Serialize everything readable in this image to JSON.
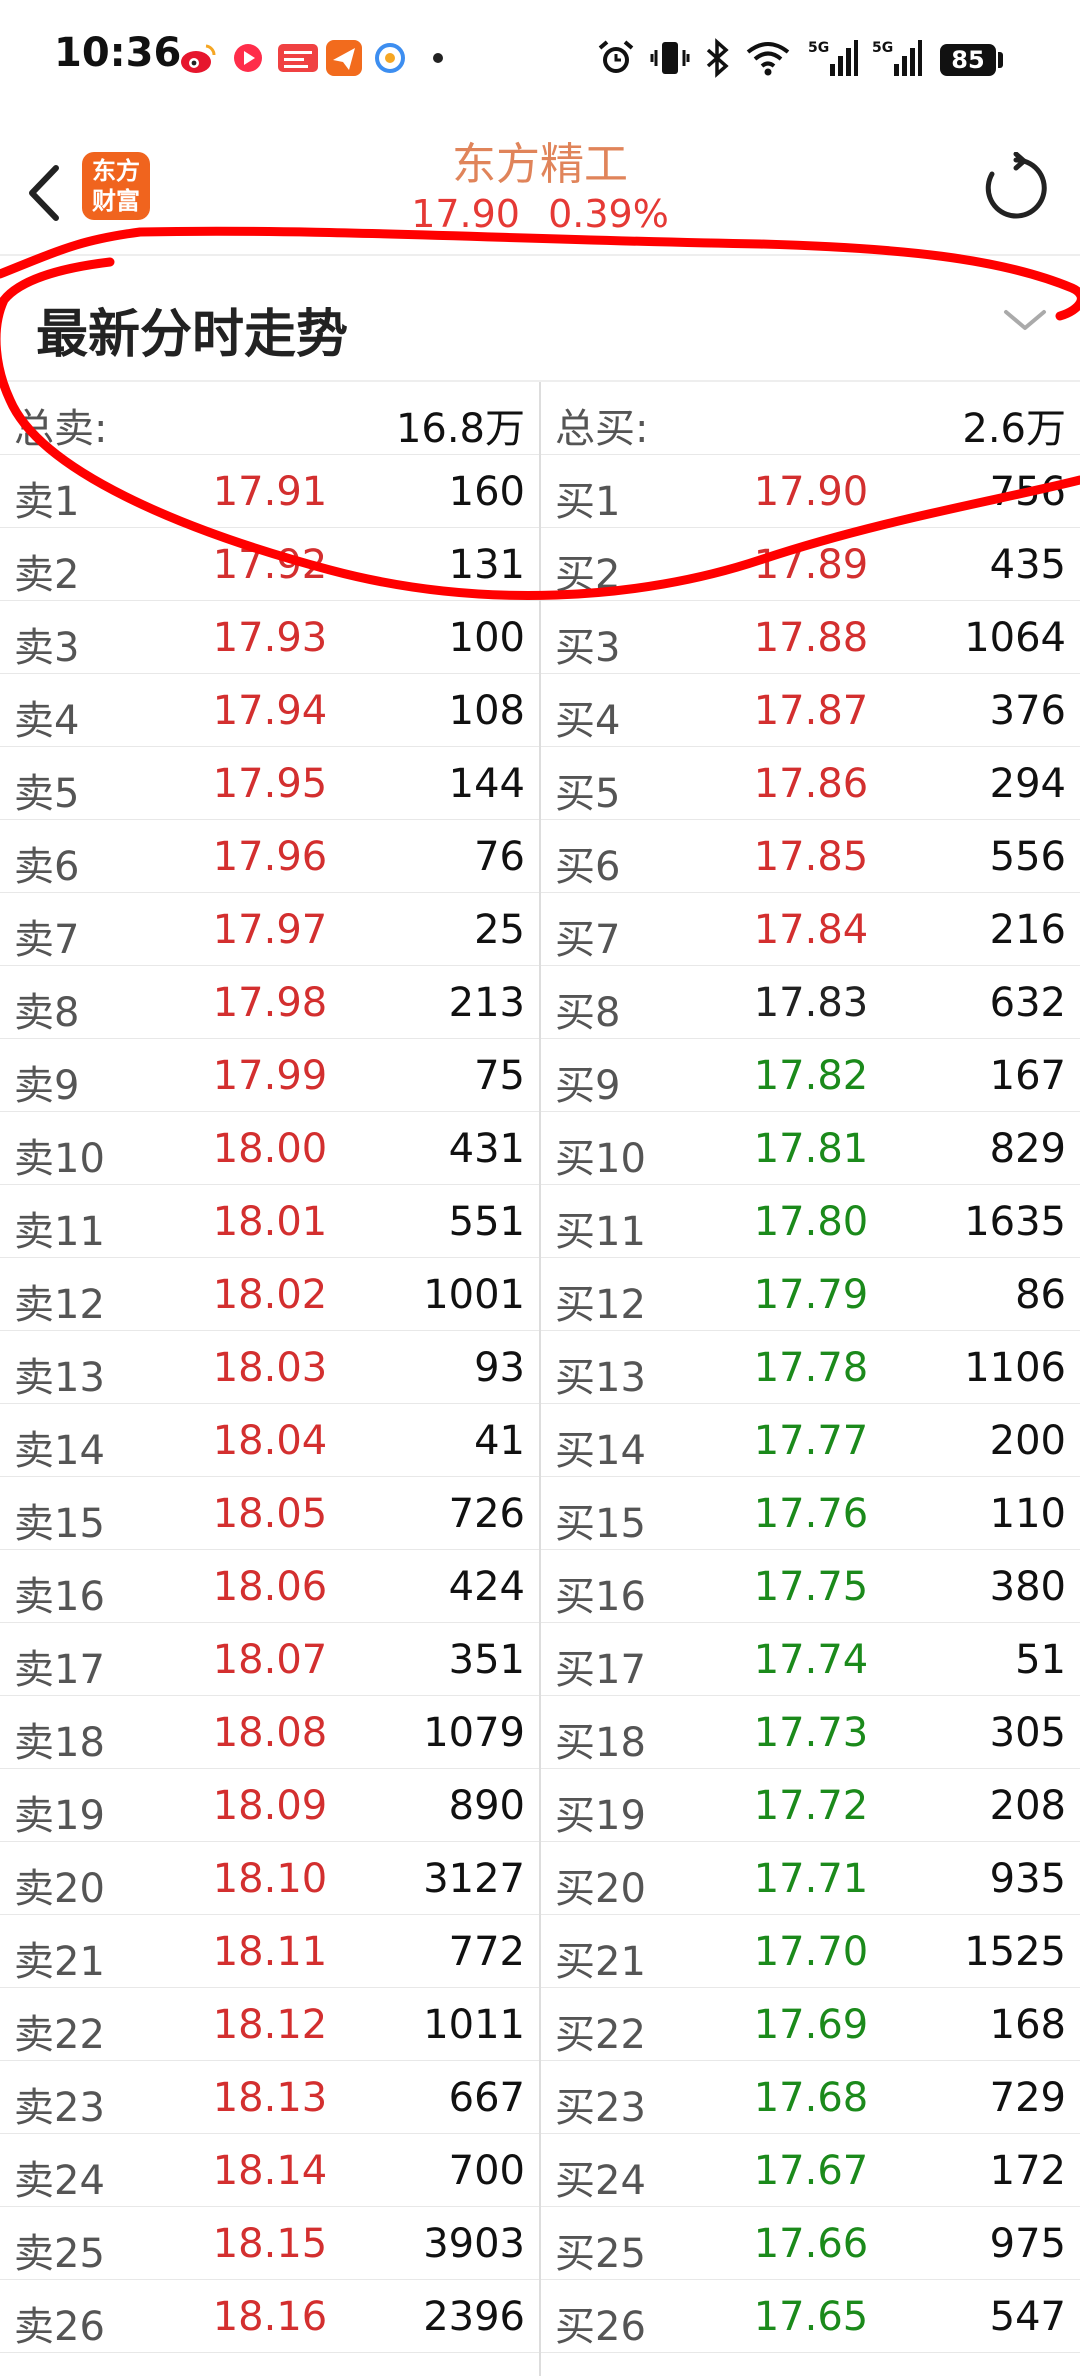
{
  "status_bar": {
    "time": "10:36",
    "battery": "85",
    "notification_icons": [
      "weibo-icon",
      "video-icon",
      "toutiao-icon",
      "paper-plane-icon",
      "browser-icon",
      "dot-icon"
    ],
    "system_icons": [
      "alarm-icon",
      "vibrate-icon",
      "bluetooth-icon",
      "wifi-icon",
      "signal-5g-icon",
      "signal-5g-icon"
    ]
  },
  "header": {
    "logo_text_line1": "东方",
    "logo_text_line2": "财富",
    "stock_name": "东方精工",
    "price": "17.90",
    "change_pct": "0.39%"
  },
  "section": {
    "title": "最新分时走势"
  },
  "totals": {
    "sell_label": "总卖:",
    "sell_value": "16.8万",
    "buy_label": "总买:",
    "buy_value": "2.6万"
  },
  "sell_rows": [
    {
      "label": "卖1",
      "price": "17.91",
      "volume": "160"
    },
    {
      "label": "卖2",
      "price": "17.92",
      "volume": "131"
    },
    {
      "label": "卖3",
      "price": "17.93",
      "volume": "100"
    },
    {
      "label": "卖4",
      "price": "17.94",
      "volume": "108"
    },
    {
      "label": "卖5",
      "price": "17.95",
      "volume": "144"
    },
    {
      "label": "卖6",
      "price": "17.96",
      "volume": "76"
    },
    {
      "label": "卖7",
      "price": "17.97",
      "volume": "25"
    },
    {
      "label": "卖8",
      "price": "17.98",
      "volume": "213"
    },
    {
      "label": "卖9",
      "price": "17.99",
      "volume": "75"
    },
    {
      "label": "卖10",
      "price": "18.00",
      "volume": "431"
    },
    {
      "label": "卖11",
      "price": "18.01",
      "volume": "551"
    },
    {
      "label": "卖12",
      "price": "18.02",
      "volume": "1001"
    },
    {
      "label": "卖13",
      "price": "18.03",
      "volume": "93"
    },
    {
      "label": "卖14",
      "price": "18.04",
      "volume": "41"
    },
    {
      "label": "卖15",
      "price": "18.05",
      "volume": "726"
    },
    {
      "label": "卖16",
      "price": "18.06",
      "volume": "424"
    },
    {
      "label": "卖17",
      "price": "18.07",
      "volume": "351"
    },
    {
      "label": "卖18",
      "price": "18.08",
      "volume": "1079"
    },
    {
      "label": "卖19",
      "price": "18.09",
      "volume": "890"
    },
    {
      "label": "卖20",
      "price": "18.10",
      "volume": "3127"
    },
    {
      "label": "卖21",
      "price": "18.11",
      "volume": "772"
    },
    {
      "label": "卖22",
      "price": "18.12",
      "volume": "1011"
    },
    {
      "label": "卖23",
      "price": "18.13",
      "volume": "667"
    },
    {
      "label": "卖24",
      "price": "18.14",
      "volume": "700"
    },
    {
      "label": "卖25",
      "price": "18.15",
      "volume": "3903"
    },
    {
      "label": "卖26",
      "price": "18.16",
      "volume": "2396"
    }
  ],
  "buy_rows": [
    {
      "label": "买1",
      "price": "17.90",
      "volume": "756",
      "color": "red"
    },
    {
      "label": "买2",
      "price": "17.89",
      "volume": "435",
      "color": "red"
    },
    {
      "label": "买3",
      "price": "17.88",
      "volume": "1064",
      "color": "red"
    },
    {
      "label": "买4",
      "price": "17.87",
      "volume": "376",
      "color": "red"
    },
    {
      "label": "买5",
      "price": "17.86",
      "volume": "294",
      "color": "red"
    },
    {
      "label": "买6",
      "price": "17.85",
      "volume": "556",
      "color": "red"
    },
    {
      "label": "买7",
      "price": "17.84",
      "volume": "216",
      "color": "red"
    },
    {
      "label": "买8",
      "price": "17.83",
      "volume": "632",
      "color": "black"
    },
    {
      "label": "买9",
      "price": "17.82",
      "volume": "167",
      "color": "green"
    },
    {
      "label": "买10",
      "price": "17.81",
      "volume": "829",
      "color": "green"
    },
    {
      "label": "买11",
      "price": "17.80",
      "volume": "1635",
      "color": "green"
    },
    {
      "label": "买12",
      "price": "17.79",
      "volume": "86",
      "color": "green"
    },
    {
      "label": "买13",
      "price": "17.78",
      "volume": "1106",
      "color": "green"
    },
    {
      "label": "买14",
      "price": "17.77",
      "volume": "200",
      "color": "green"
    },
    {
      "label": "买15",
      "price": "17.76",
      "volume": "110",
      "color": "green"
    },
    {
      "label": "买16",
      "price": "17.75",
      "volume": "380",
      "color": "green"
    },
    {
      "label": "买17",
      "price": "17.74",
      "volume": "51",
      "color": "green"
    },
    {
      "label": "买18",
      "price": "17.73",
      "volume": "305",
      "color": "green"
    },
    {
      "label": "买19",
      "price": "17.72",
      "volume": "208",
      "color": "green"
    },
    {
      "label": "买20",
      "price": "17.71",
      "volume": "935",
      "color": "green"
    },
    {
      "label": "买21",
      "price": "17.70",
      "volume": "1525",
      "color": "green"
    },
    {
      "label": "买22",
      "price": "17.69",
      "volume": "168",
      "color": "green"
    },
    {
      "label": "买23",
      "price": "17.68",
      "volume": "729",
      "color": "green"
    },
    {
      "label": "买24",
      "price": "17.67",
      "volume": "172",
      "color": "green"
    },
    {
      "label": "买25",
      "price": "17.66",
      "volume": "975",
      "color": "green"
    },
    {
      "label": "买26",
      "price": "17.65",
      "volume": "547",
      "color": "green"
    }
  ],
  "colors": {
    "up": "#d32f2f",
    "down": "#1b8a1b",
    "flat": "#222222",
    "brand": "#f0641e",
    "annotation": "#ff0000"
  }
}
